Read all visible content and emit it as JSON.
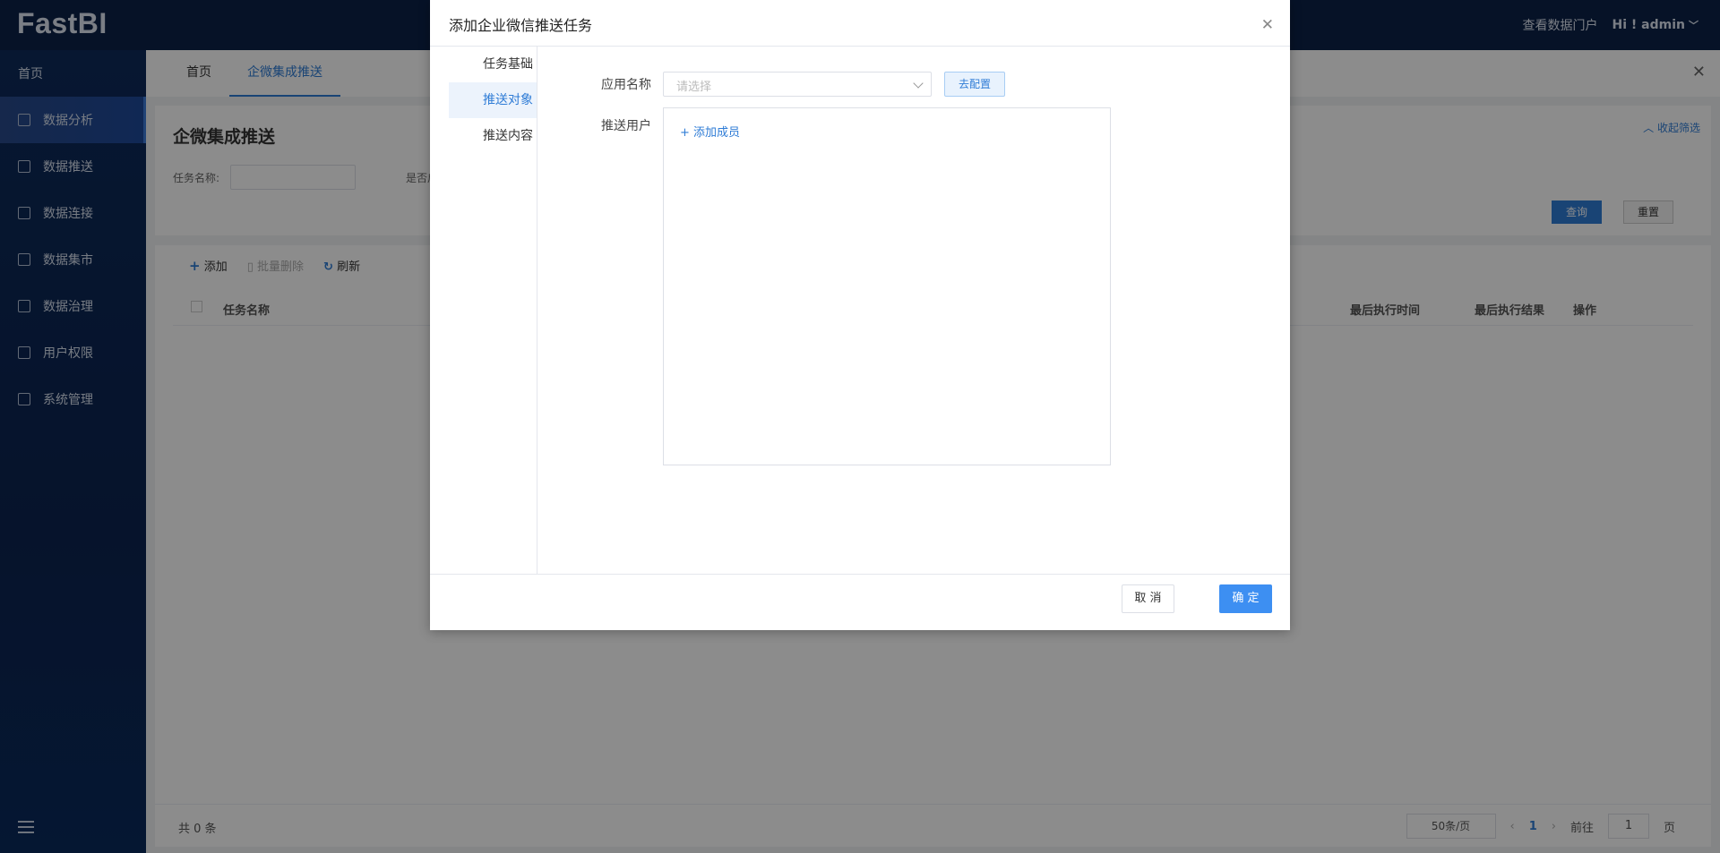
{
  "app": {
    "logo": "FastBI"
  },
  "topbar": {
    "portal_link": "查看数据门户",
    "user": "Hi ! admin"
  },
  "sidebar": {
    "items": [
      {
        "label": "首页",
        "icon": "home-icon"
      },
      {
        "label": "数据分析",
        "icon": "chart-icon",
        "active": true
      },
      {
        "label": "数据推送",
        "icon": "bar-chart-icon"
      },
      {
        "label": "数据连接",
        "icon": "link-icon"
      },
      {
        "label": "数据集市",
        "icon": "monitor-icon"
      },
      {
        "label": "数据治理",
        "icon": "layers-icon"
      },
      {
        "label": "用户权限",
        "icon": "org-icon"
      },
      {
        "label": "系统管理",
        "icon": "users-icon"
      }
    ]
  },
  "tabs": [
    {
      "label": "首页",
      "active": false
    },
    {
      "label": "企微集成推送",
      "active": true
    }
  ],
  "page": {
    "title": "企微集成推送",
    "collapse_label": "收起筛选",
    "filter": {
      "task_name_label": "任务名称:",
      "enabled_label": "是否启",
      "query_button": "查询",
      "reset_button": "重置"
    },
    "toolbar": {
      "add": "添加",
      "batch_delete": "批量删除",
      "refresh": "刷新"
    },
    "table": {
      "columns": [
        "任务名称",
        "最后执行时间",
        "最后执行结果",
        "操作"
      ]
    },
    "footer": {
      "total": "共 0 条",
      "page_size": "50条/页",
      "current_page": "1",
      "goto_prefix": "前往",
      "goto_value": "1",
      "goto_suffix": "页"
    }
  },
  "dialog": {
    "title": "添加企业微信推送任务",
    "steps": [
      {
        "label": "任务基础",
        "active": false
      },
      {
        "label": "推送对象",
        "active": true
      },
      {
        "label": "推送内容",
        "active": false
      }
    ],
    "app_name_label": "应用名称",
    "app_select_placeholder": "请选择",
    "configure_button": "去配置",
    "push_user_label": "推送用户",
    "add_member": "添加成员",
    "cancel_button": "取 消",
    "ok_button": "确 定"
  }
}
